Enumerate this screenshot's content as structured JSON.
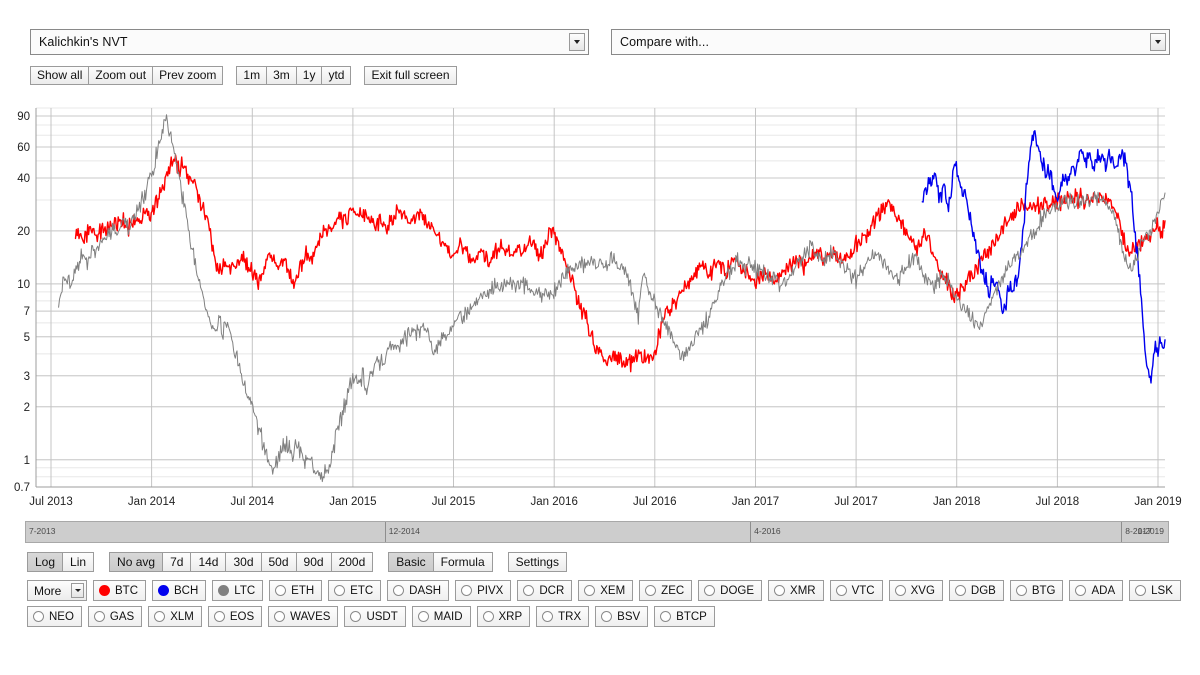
{
  "header": {
    "metric_select": {
      "value": "Kalichkin's NVT",
      "name": "metric-select"
    },
    "compare_select": {
      "value": "Compare with...",
      "name": "compare-select"
    }
  },
  "toolbar": {
    "zoom_group": [
      "Show all",
      "Zoom out",
      "Prev zoom"
    ],
    "range_group": [
      "1m",
      "3m",
      "1y",
      "ytd"
    ],
    "fullscreen_label": "Exit full screen"
  },
  "controls": {
    "scale_group": {
      "options": [
        "Log",
        "Lin"
      ],
      "selected": "Log"
    },
    "avg_group": {
      "options": [
        "No avg",
        "7d",
        "14d",
        "30d",
        "50d",
        "90d",
        "200d"
      ],
      "selected": "No avg"
    },
    "mode_group": {
      "options": [
        "Basic",
        "Formula"
      ],
      "selected": "Basic"
    },
    "settings_label": "Settings",
    "more_label": "More"
  },
  "coins": {
    "row1": [
      {
        "label": "BTC",
        "color": "#ff0000",
        "active": true
      },
      {
        "label": "BCH",
        "color": "#0000ee",
        "active": true
      },
      {
        "label": "LTC",
        "color": "#808080",
        "active": true
      },
      {
        "label": "ETH",
        "color": "",
        "active": false
      },
      {
        "label": "ETC",
        "color": "",
        "active": false
      },
      {
        "label": "DASH",
        "color": "",
        "active": false
      },
      {
        "label": "PIVX",
        "color": "",
        "active": false
      },
      {
        "label": "DCR",
        "color": "",
        "active": false
      },
      {
        "label": "XEM",
        "color": "",
        "active": false
      },
      {
        "label": "ZEC",
        "color": "",
        "active": false
      },
      {
        "label": "DOGE",
        "color": "",
        "active": false
      },
      {
        "label": "XMR",
        "color": "",
        "active": false
      },
      {
        "label": "VTC",
        "color": "",
        "active": false
      },
      {
        "label": "XVG",
        "color": "",
        "active": false
      },
      {
        "label": "DGB",
        "color": "",
        "active": false
      },
      {
        "label": "BTG",
        "color": "",
        "active": false
      },
      {
        "label": "ADA",
        "color": "",
        "active": false
      },
      {
        "label": "LSK",
        "color": "",
        "active": false
      }
    ],
    "row2": [
      {
        "label": "NEO",
        "color": "",
        "active": false
      },
      {
        "label": "GAS",
        "color": "",
        "active": false
      },
      {
        "label": "XLM",
        "color": "",
        "active": false
      },
      {
        "label": "EOS",
        "color": "",
        "active": false
      },
      {
        "label": "WAVES",
        "color": "",
        "active": false
      },
      {
        "label": "USDT",
        "color": "",
        "active": false
      },
      {
        "label": "MAID",
        "color": "",
        "active": false
      },
      {
        "label": "XRP",
        "color": "",
        "active": false
      },
      {
        "label": "TRX",
        "color": "",
        "active": false
      },
      {
        "label": "BSV",
        "color": "",
        "active": false
      },
      {
        "label": "BTCP",
        "color": "",
        "active": false
      }
    ]
  },
  "navigator": {
    "segments": [
      {
        "label": "7-2013",
        "width_pct": 31.5,
        "align": "left"
      },
      {
        "label": "12-2014",
        "width_pct": 32.0,
        "align": "left"
      },
      {
        "label": "4-2016",
        "width_pct": 32.5,
        "align": "left"
      },
      {
        "label": "8-2017",
        "width_pct": 4.0,
        "align": "left"
      }
    ],
    "end_label": "1-2019"
  },
  "chart_data": {
    "type": "line",
    "title": "Kalichkin's NVT",
    "xlabel": "",
    "ylabel": "",
    "yscale": "log",
    "ylim": [
      0.7,
      100
    ],
    "grid": true,
    "legend": "bottom",
    "yticks": [
      0.7,
      1,
      2,
      3,
      5,
      7,
      10,
      20,
      40,
      60,
      90
    ],
    "ytick_labels": [
      "0.7",
      "1",
      "2",
      "3",
      "5",
      "7",
      "10",
      "20",
      "40",
      "60",
      "90"
    ],
    "xticks": [
      "Jul 2013",
      "Jan 2014",
      "Jul 2014",
      "Jan 2015",
      "Jul 2015",
      "Jan 2016",
      "Jul 2016",
      "Jan 2017",
      "Jul 2017",
      "Jan 2018",
      "Jul 2018",
      "Jan 2019"
    ],
    "x_start": "2013-05",
    "x_end": "2019-02",
    "series": [
      {
        "name": "BTC",
        "color": "#ff0000",
        "x_start_frac": 0.035,
        "values": [
          18.5,
          19.2,
          18.0,
          19.5,
          20.5,
          19.0,
          20.0,
          21.5,
          20.0,
          22.0,
          21.0,
          23.0,
          22.0,
          21.0,
          23.5,
          22.0,
          24.0,
          26.0,
          24.0,
          27.0,
          30.0,
          34.0,
          40.0,
          46.0,
          52.0,
          44.0,
          47.0,
          40.0,
          42.0,
          36.0,
          30.0,
          26.0,
          22.0,
          17.0,
          13.0,
          11.5,
          13.0,
          12.0,
          13.5,
          12.5,
          14.0,
          13.0,
          12.0,
          11.0,
          10.5,
          11.5,
          13.0,
          14.5,
          13.5,
          12.0,
          14.0,
          12.5,
          11.0,
          10.3,
          12.0,
          13.5,
          15.0,
          14.0,
          16.0,
          18.0,
          20.0,
          21.0,
          22.0,
          23.5,
          24.0,
          23.0,
          25.0,
          26.0,
          25.0,
          24.0,
          25.5,
          24.0,
          22.0,
          23.0,
          22.0,
          21.0,
          22.5,
          24.0,
          26.0,
          25.0,
          24.0,
          22.0,
          23.5,
          25.0,
          24.0,
          22.5,
          21.0,
          20.0,
          18.0,
          16.5,
          15.0,
          14.0,
          15.5,
          16.5,
          15.0,
          14.0,
          13.5,
          14.5,
          15.5,
          14.5,
          13.5,
          14.5,
          15.5,
          16.5,
          15.5,
          14.5,
          15.5,
          16.0,
          15.0,
          16.0,
          17.5,
          16.0,
          14.5,
          16.0,
          18.0,
          20.0,
          18.0,
          16.0,
          13.5,
          12.0,
          10.0,
          8.5,
          7.5,
          6.5,
          5.5,
          4.8,
          4.2,
          3.8,
          3.6,
          3.7,
          3.9,
          3.8,
          3.7,
          3.6,
          3.7,
          3.8,
          4.0,
          3.8,
          3.7,
          3.8,
          4.0,
          5.5,
          6.5,
          7.0,
          7.5,
          8.0,
          8.5,
          9.5,
          10.5,
          11.0,
          12.0,
          13.0,
          12.0,
          11.0,
          12.5,
          13.5,
          12.5,
          11.5,
          12.5,
          13.5,
          12.5,
          11.5,
          12.0,
          11.0,
          10.5,
          11.0,
          12.0,
          11.5,
          10.5,
          10.0,
          11.0,
          12.0,
          12.5,
          13.0,
          14.0,
          13.5,
          12.5,
          13.5,
          14.5,
          15.5,
          14.5,
          13.5,
          14.5,
          15.0,
          14.0,
          13.0,
          14.0,
          15.0,
          16.0,
          17.0,
          18.0,
          19.5,
          21.0,
          23.0,
          25.0,
          27.0,
          29.0,
          27.0,
          25.0,
          23.0,
          21.0,
          19.0,
          17.5,
          16.0,
          17.5,
          19.0,
          17.0,
          15.0,
          13.0,
          11.5,
          10.5,
          9.5,
          9.0,
          8.5,
          9.5,
          10.5,
          11.5,
          12.0,
          13.0,
          14.0,
          15.0,
          16.0,
          17.5,
          19.0,
          20.5,
          22.0,
          24.0,
          26.0,
          27.5,
          29.0,
          28.0,
          27.0,
          28.0,
          29.0,
          28.5,
          28.0,
          29.0,
          30.0,
          29.5,
          30.0,
          30.5,
          31.0,
          30.5,
          31.0,
          31.0,
          30.5,
          30.5,
          31.0,
          30.5,
          30.0,
          29.0,
          26.0,
          22.0,
          18.0,
          16.0,
          15.0,
          16.0,
          17.0,
          18.0,
          19.0,
          20.0,
          21.0,
          20.0,
          21.0
        ]
      },
      {
        "name": "BCH",
        "color": "#0000ee",
        "x_start_frac": 0.785,
        "values": [
          30.0,
          36.0,
          32.0,
          40.0,
          34.0,
          44.0,
          36.0,
          30.0,
          33.0,
          38.0,
          30.0,
          28.0,
          32.0,
          44.0,
          50.0,
          42.0,
          36.0,
          30.0,
          33.0,
          28.0,
          24.0,
          20.0,
          17.0,
          15.0,
          13.5,
          12.0,
          11.0,
          10.0,
          9.0,
          10.0,
          11.0,
          10.0,
          9.0,
          8.0,
          7.0,
          7.5,
          8.5,
          10.0,
          9.0,
          10.0,
          11.0,
          13.0,
          18.0,
          26.0,
          38.0,
          50.0,
          62.0,
          72.0,
          66.0,
          58.0,
          52.0,
          46.0,
          42.0,
          45.0,
          40.0,
          36.0,
          32.0,
          30.0,
          34.0,
          38.0,
          42.0,
          38.0,
          40.0,
          44.0,
          42.0,
          46.0,
          52.0,
          58.0,
          54.0,
          50.0,
          56.0,
          52.0,
          48.0,
          50.0,
          54.0,
          56.0,
          52.0,
          48.0,
          50.0,
          52.0,
          48.0,
          45.0,
          48.0,
          52.0,
          55.0,
          50.0,
          44.0,
          38.0,
          30.0,
          22.0,
          16.0,
          12.0,
          8.0,
          5.5,
          4.2,
          3.2,
          2.8,
          3.6,
          4.5,
          4.2,
          4.6,
          4.3,
          4.5
        ]
      },
      {
        "name": "LTC",
        "color": "#808080",
        "x_start_frac": 0.02,
        "values": [
          8.0,
          9.5,
          11.0,
          10.5,
          12.0,
          13.0,
          14.0,
          13.0,
          15.0,
          16.0,
          17.0,
          18.0,
          19.0,
          20.0,
          19.0,
          21.0,
          22.0,
          21.0,
          23.0,
          25.0,
          28.0,
          32.0,
          38.0,
          46.0,
          58.0,
          72.0,
          85.0,
          70.0,
          55.0,
          42.0,
          32.0,
          24.0,
          18.0,
          14.0,
          11.0,
          9.0,
          7.2,
          5.8,
          5.2,
          6.5,
          5.0,
          6.2,
          4.8,
          4.0,
          3.4,
          2.8,
          2.4,
          2.0,
          1.7,
          1.4,
          1.2,
          1.0,
          0.88,
          0.95,
          1.1,
          1.3,
          1.15,
          1.05,
          1.25,
          1.1,
          0.95,
          1.05,
          0.9,
          0.82,
          0.78,
          0.85,
          0.95,
          1.2,
          1.5,
          1.9,
          2.3,
          2.7,
          3.0,
          2.6,
          3.1,
          2.4,
          3.2,
          3.6,
          3.4,
          3.8,
          4.1,
          4.4,
          4.2,
          4.6,
          4.9,
          5.2,
          5.5,
          5.3,
          5.6,
          5.4,
          5.2,
          4.0,
          4.4,
          4.8,
          5.0,
          5.4,
          5.8,
          6.2,
          6.6,
          7.0,
          7.4,
          7.8,
          8.2,
          8.6,
          9.0,
          9.5,
          9.8,
          9.5,
          10.0,
          10.5,
          10.2,
          9.8,
          10.2,
          9.8,
          9.5,
          9.0,
          8.6,
          9.0,
          8.5,
          9.2,
          8.8,
          9.5,
          10.0,
          11.0,
          12.0,
          13.0,
          12.0,
          13.5,
          12.5,
          14.0,
          13.0,
          12.5,
          13.0,
          12.0,
          13.5,
          14.0,
          13.0,
          12.0,
          11.5,
          10.0,
          8.0,
          6.5,
          11.0,
          10.0,
          9.0,
          8.0,
          7.0,
          6.2,
          5.6,
          5.0,
          4.6,
          4.2,
          4.0,
          4.2,
          4.6,
          5.0,
          5.5,
          6.0,
          6.5,
          7.5,
          8.5,
          9.5,
          10.5,
          11.5,
          12.5,
          13.5,
          13.0,
          12.0,
          13.0,
          12.5,
          11.5,
          12.0,
          11.0,
          10.5,
          11.0,
          10.0,
          9.5,
          10.5,
          11.5,
          12.5,
          13.5,
          14.5,
          15.5,
          16.5,
          15.5,
          14.5,
          13.5,
          14.5,
          15.5,
          14.5,
          13.5,
          12.5,
          11.5,
          11.0,
          10.5,
          11.5,
          12.5,
          13.5,
          14.5,
          15.0,
          14.0,
          13.0,
          12.0,
          11.0,
          10.5,
          11.5,
          12.5,
          13.5,
          14.0,
          13.0,
          12.0,
          11.0,
          10.0,
          9.5,
          10.5,
          11.5,
          10.5,
          9.5,
          8.5,
          8.0,
          7.5,
          7.0,
          6.5,
          6.0,
          5.5,
          6.5,
          7.5,
          8.5,
          9.5,
          10.5,
          11.5,
          12.5,
          13.5,
          14.5,
          15.5,
          16.5,
          18.0,
          20.0,
          22.0,
          24.0,
          26.0,
          25.0,
          26.0,
          27.0,
          28.0,
          29.0,
          30.0,
          29.0,
          30.0,
          31.0,
          30.0,
          31.0,
          30.5,
          31.0,
          30.0,
          29.0,
          26.0,
          22.0,
          18.0,
          15.0,
          13.0,
          12.0,
          14.0,
          16.0,
          18.0,
          20.0,
          22.0,
          25.0,
          28.0,
          32.0
        ]
      }
    ]
  }
}
